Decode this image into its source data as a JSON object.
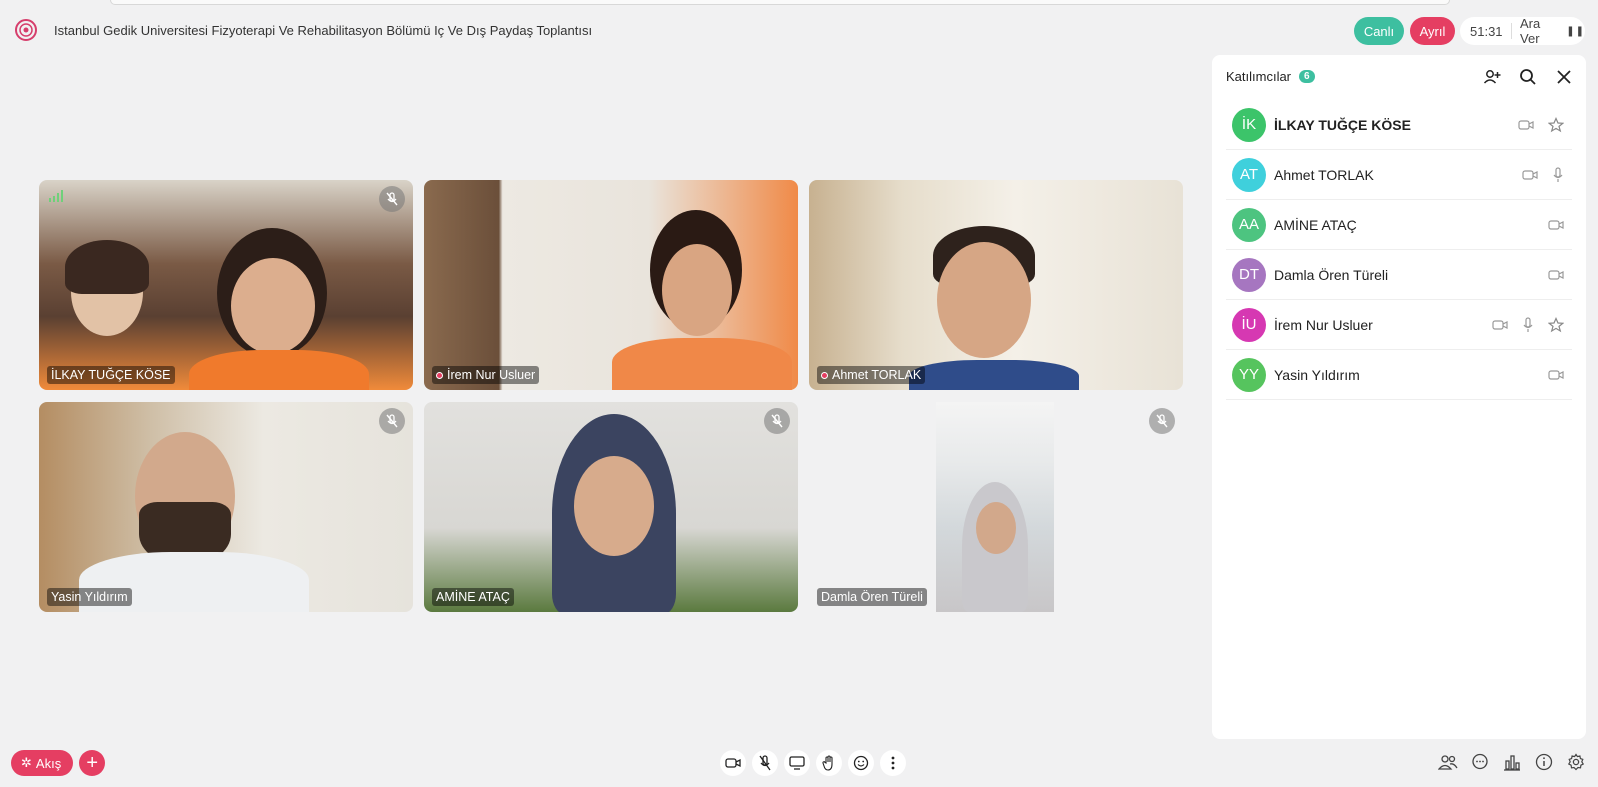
{
  "header": {
    "meeting_title": "Istanbul Gedik Universitesi Fizyoterapi Ve Rehabilitasyon Bölümü Iç Ve Dış Paydaş Toplantısı",
    "live_label": "Canlı",
    "record_label": "Ayrıl",
    "timer": "51:31",
    "break_label": "Ara Ver",
    "logo_icon": "university-logo-icon"
  },
  "videos": [
    {
      "name": "İLKAY TUĞÇE KÖSE",
      "muted": true,
      "speaking_dot": false
    },
    {
      "name": "İrem Nur Usluer",
      "muted": false,
      "speaking_dot": true
    },
    {
      "name": "Ahmet TORLAK",
      "muted": false,
      "speaking_dot": true
    },
    {
      "name": "Yasin Yıldırım",
      "muted": true,
      "speaking_dot": false
    },
    {
      "name": "AMİNE ATAÇ",
      "muted": true,
      "speaking_dot": false
    },
    {
      "name": "Damla Ören Türeli",
      "muted": true,
      "speaking_dot": false
    }
  ],
  "panel": {
    "title": "Katılımcılar",
    "count": "6",
    "participants": [
      {
        "initials": "İK",
        "name": "İLKAY TUĞÇE KÖSE",
        "color": "#3cc46a",
        "bold": true
      },
      {
        "initials": "AT",
        "name": "Ahmet TORLAK",
        "color": "#3fd0dc",
        "bold": false
      },
      {
        "initials": "AA",
        "name": "AMİNE ATAÇ",
        "color": "#4dc480",
        "bold": false
      },
      {
        "initials": "DT",
        "name": "Damla Ören Türeli",
        "color": "#a676c0",
        "bold": false
      },
      {
        "initials": "İU",
        "name": "İrem Nur Usluer",
        "color": "#d638b2",
        "bold": false
      },
      {
        "initials": "YY",
        "name": "Yasin Yıldırım",
        "color": "#56c45e",
        "bold": false
      }
    ]
  },
  "bottom": {
    "flow_label": "Akış",
    "add_label": "+"
  },
  "colors": {
    "accent_green": "#3dbfa0",
    "accent_red": "#e53e62"
  }
}
